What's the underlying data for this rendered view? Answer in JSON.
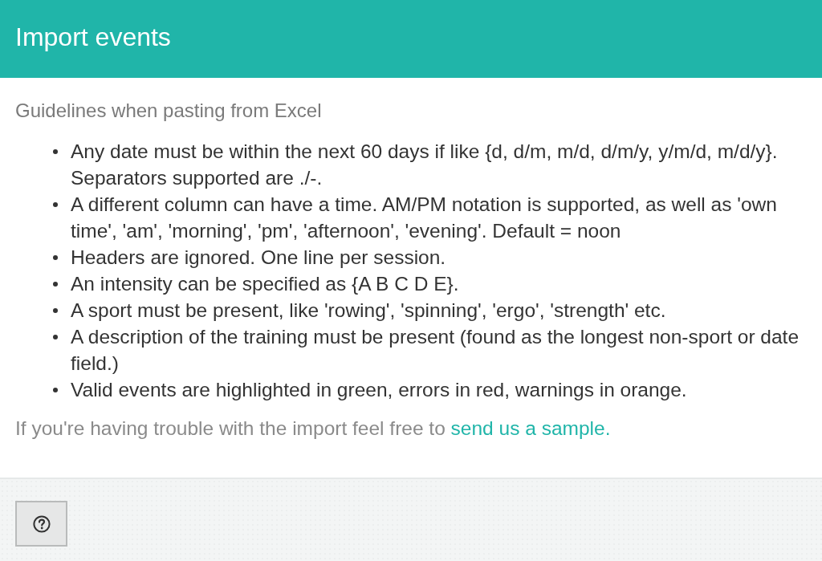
{
  "dialog": {
    "title": "Import events"
  },
  "intro": "Guidelines when pasting from Excel",
  "guidelines": [
    "Any date must be within the next 60 days if like {d, d/m, m/d, d/m/y, y/m/d, m/d/y}. Separators supported are ./-.",
    "A different column can have a time. AM/PM notation is supported, as well as 'own time', 'am', 'morning', 'pm', 'afternoon', 'evening'. Default = noon",
    "Headers are ignored. One line per session.",
    "An intensity can be specified as {A B C D E}.",
    "A sport must be present, like 'rowing', 'spinning', 'ergo', 'strength' etc.",
    "A description of the training must be present (found as the longest non-sport or date field.)",
    "Valid events are highlighted in green, errors in red, warnings in orange."
  ],
  "help_note": {
    "text": "If you're having trouble with the import feel free to",
    "link": "send us a sample."
  }
}
